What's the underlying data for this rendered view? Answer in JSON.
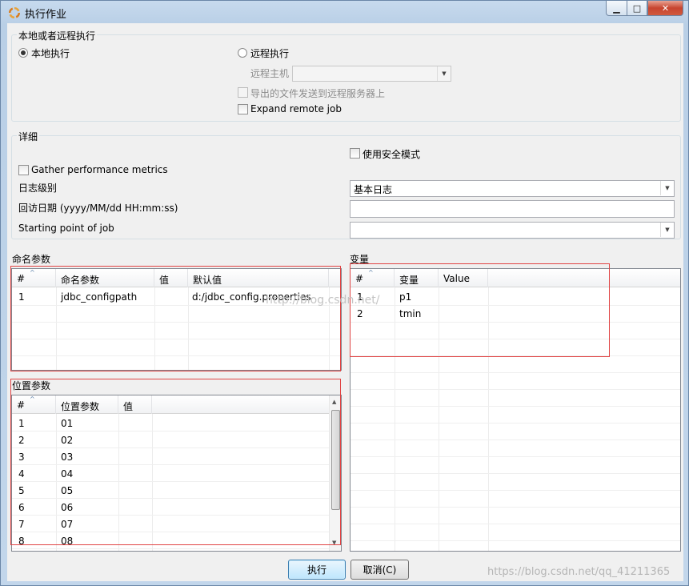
{
  "window": {
    "title": "执行作业",
    "min_glyph": "▁",
    "max_glyph": "□",
    "close_glyph": "✕"
  },
  "location": {
    "group_label": "本地或者远程执行",
    "local_label": "本地执行",
    "remote_label": "远程执行",
    "remote_host_label": "远程主机",
    "remote_host_value": "",
    "send_files_label": "导出的文件发送到远程服务器上",
    "expand_remote_label": "Expand remote job"
  },
  "details": {
    "group_label": "详细",
    "safe_mode_label": "使用安全模式",
    "gather_metrics_label": "Gather performance metrics",
    "log_level_label": "日志级别",
    "log_level_value": "基本日志",
    "replay_date_label": "回访日期 (yyyy/MM/dd HH:mm:ss)",
    "replay_date_value": "",
    "start_point_label": "Starting point of job",
    "start_point_value": ""
  },
  "named_params": {
    "section_label": "命名参数",
    "columns": [
      "#",
      "命名参数",
      "值",
      "默认值"
    ],
    "rows": [
      {
        "num": "1",
        "name": "jdbc_configpath",
        "value": "",
        "default": "d:/jdbc_config.properties"
      }
    ]
  },
  "variables": {
    "section_label": "变量",
    "columns": [
      "#",
      "变量",
      "Value"
    ],
    "rows": [
      {
        "num": "1",
        "name": "p1",
        "value": ""
      },
      {
        "num": "2",
        "name": "tmin",
        "value": ""
      }
    ]
  },
  "positional_params": {
    "section_label": "位置参数",
    "columns": [
      "#",
      "位置参数",
      "值"
    ],
    "rows": [
      {
        "num": "1",
        "param": "01"
      },
      {
        "num": "2",
        "param": "02"
      },
      {
        "num": "3",
        "param": "03"
      },
      {
        "num": "4",
        "param": "04"
      },
      {
        "num": "5",
        "param": "05"
      },
      {
        "num": "6",
        "param": "06"
      },
      {
        "num": "7",
        "param": "07"
      },
      {
        "num": "8",
        "param": "08"
      }
    ]
  },
  "buttons": {
    "run": "执行",
    "cancel": "取消(C)"
  },
  "watermarks": {
    "center": "http://blog.csdn.net/",
    "corner": "https://blog.csdn.net/qq_41211365"
  },
  "colors": {
    "annotation_red": "#e04444",
    "default_button_blue": "#3c7fb1"
  }
}
